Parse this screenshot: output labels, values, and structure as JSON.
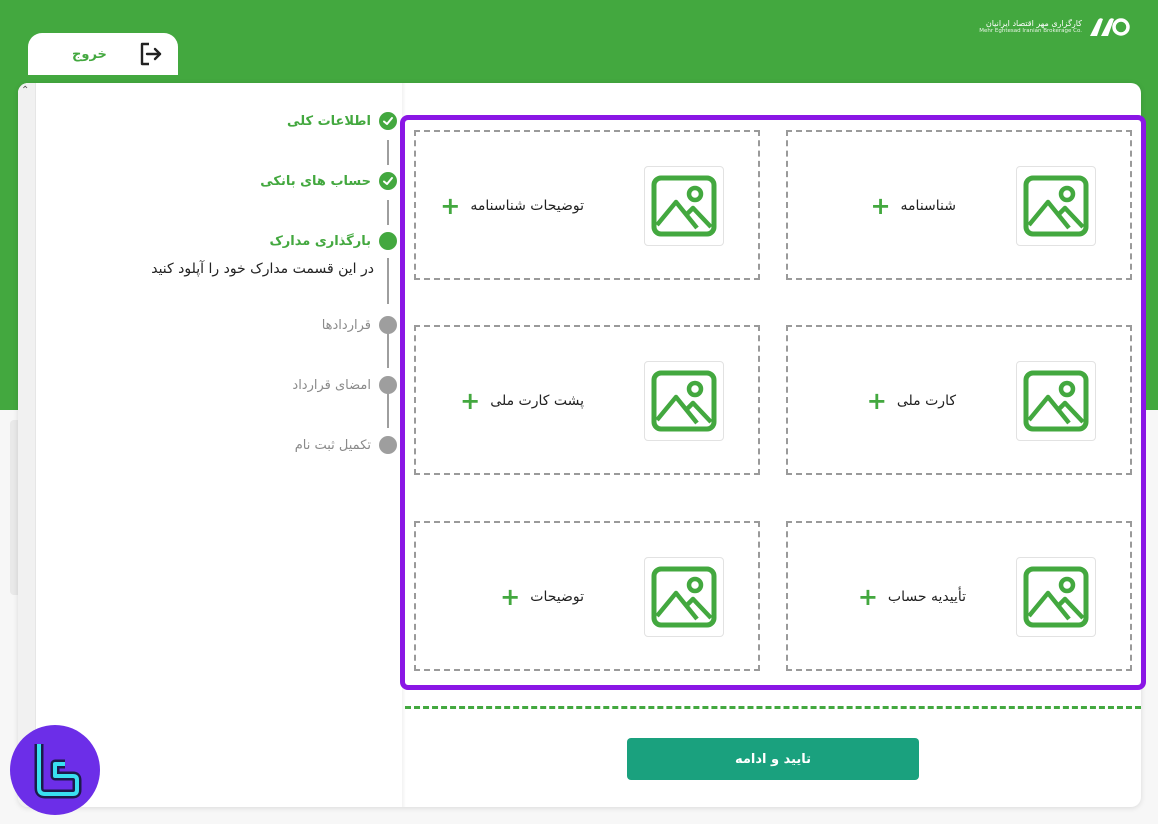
{
  "brand": {
    "name_fa": "کارگزاری مهر اقتصاد ایرانیان",
    "name_en": "Mehr Eghtesad Iranian Brokerage Co."
  },
  "header": {
    "logout_label": "خروج"
  },
  "stepper": {
    "steps": [
      {
        "label": "اطلاعات کلی",
        "state": "done"
      },
      {
        "label": "حساب های بانکی",
        "state": "done"
      },
      {
        "label": "بارگذاری مدارک",
        "state": "active",
        "description": "در این قسمت مدارک خود را آپلود کنید"
      },
      {
        "label": "قراردادها",
        "state": "todo"
      },
      {
        "label": "امضای قرارداد",
        "state": "todo"
      },
      {
        "label": "تکمیل ثبت نام",
        "state": "todo"
      }
    ]
  },
  "uploads": {
    "slots": [
      {
        "label": "شناسنامه"
      },
      {
        "label": "توضیحات شناسنامه"
      },
      {
        "label": "کارت ملی"
      },
      {
        "label": "پشت کارت ملی"
      },
      {
        "label": "تأییدیه حساب"
      },
      {
        "label": "توضیحات"
      }
    ]
  },
  "actions": {
    "continue_label": "تایید و ادامه"
  },
  "colors": {
    "brand_green": "#43a83f",
    "frame_purple": "#8a16e5",
    "button_teal": "#1aa17e",
    "inactive_gray": "#9e9e9e"
  },
  "icons": {
    "logout": "logout-icon",
    "check": "check-icon",
    "image_placeholder": "image-icon",
    "plus": "plus-icon",
    "scroll_up": "chevron-up-icon"
  }
}
